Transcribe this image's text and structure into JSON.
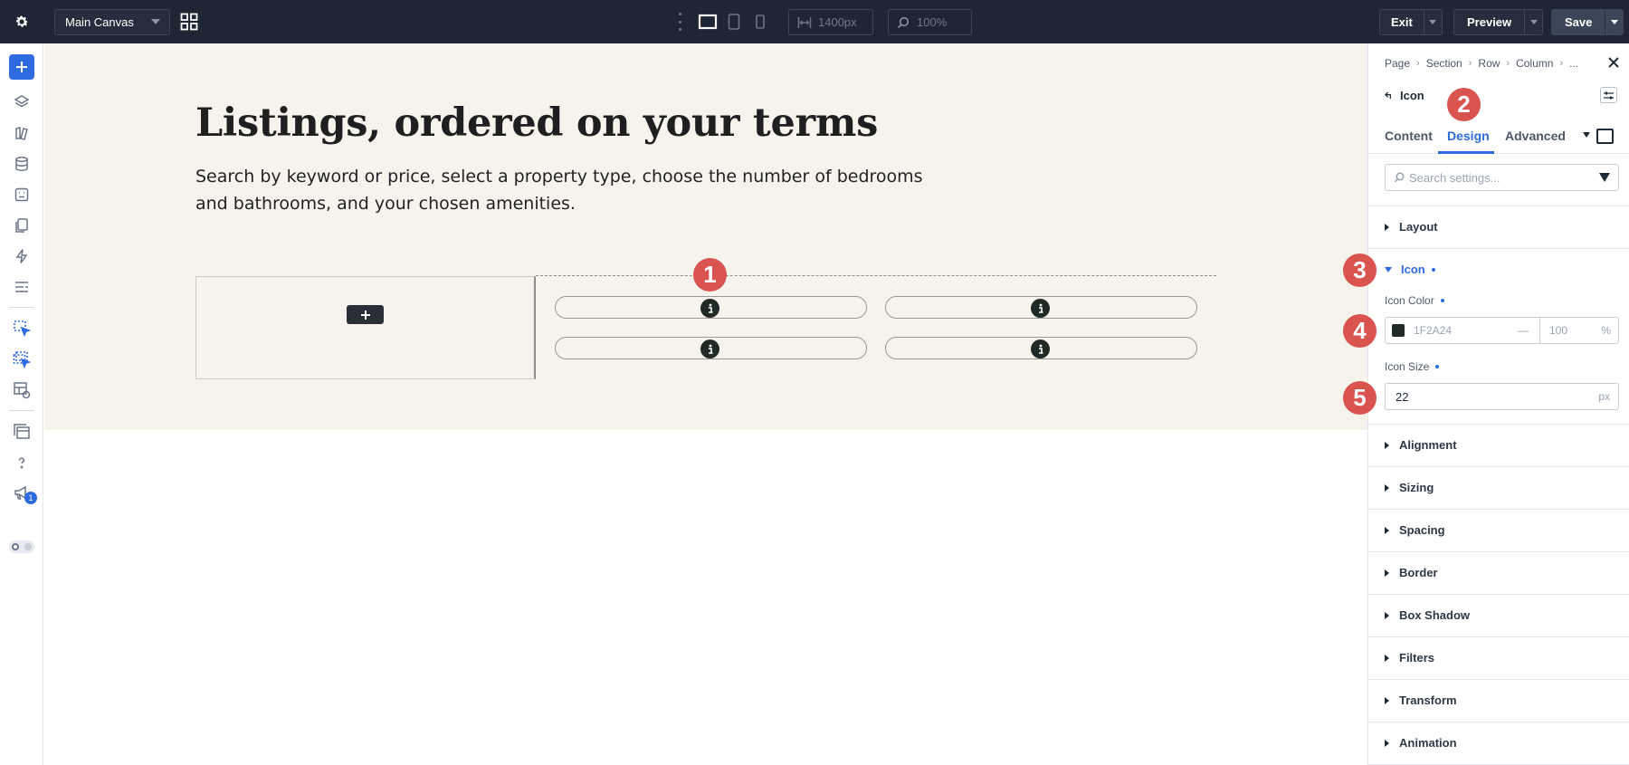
{
  "topbar": {
    "canvas_select": "Main Canvas",
    "width_value": "1400px",
    "zoom_value": "100%",
    "exit_label": "Exit",
    "preview_label": "Preview",
    "save_label": "Save"
  },
  "sidebar": {
    "notification_count": "1"
  },
  "hero": {
    "title": "Listings, ordered on your terms",
    "text": "Search by keyword or price, select a property type, choose the number of bedrooms and bathrooms, and your chosen amenities."
  },
  "markers": [
    "1",
    "2",
    "3",
    "4",
    "5"
  ],
  "panel": {
    "breadcrumbs": [
      "Page",
      "Section",
      "Row",
      "Column",
      "..."
    ],
    "module_name": "Icon",
    "tabs": [
      "Content",
      "Design",
      "Advanced"
    ],
    "active_tab": "Design",
    "search_placeholder": "Search settings...",
    "sections": {
      "layout": "Layout",
      "icon": "Icon",
      "alignment": "Alignment",
      "sizing": "Sizing",
      "spacing": "Spacing",
      "border": "Border",
      "box_shadow": "Box Shadow",
      "filters": "Filters",
      "transform": "Transform",
      "animation": "Animation"
    },
    "icon_color": {
      "label": "Icon Color",
      "hex": "1F2A24",
      "dash": "—",
      "opacity": "100",
      "opacity_unit": "%"
    },
    "icon_size": {
      "label": "Icon Size",
      "value": "22",
      "unit": "px"
    }
  },
  "colors": {
    "topbar_bg": "#1e2533",
    "accent": "#2f6be0",
    "marker": "#d9534f",
    "hero_bg": "#f6f3ed",
    "icon_color": "#1F2A24"
  },
  "icons": [
    "gear-icon",
    "grid-icon",
    "desktop-icon",
    "tablet-icon",
    "phone-icon",
    "width-icon",
    "zoom-icon",
    "plus-icon",
    "layers-icon",
    "info-icon",
    "close-icon",
    "search-icon",
    "filter-icon"
  ]
}
